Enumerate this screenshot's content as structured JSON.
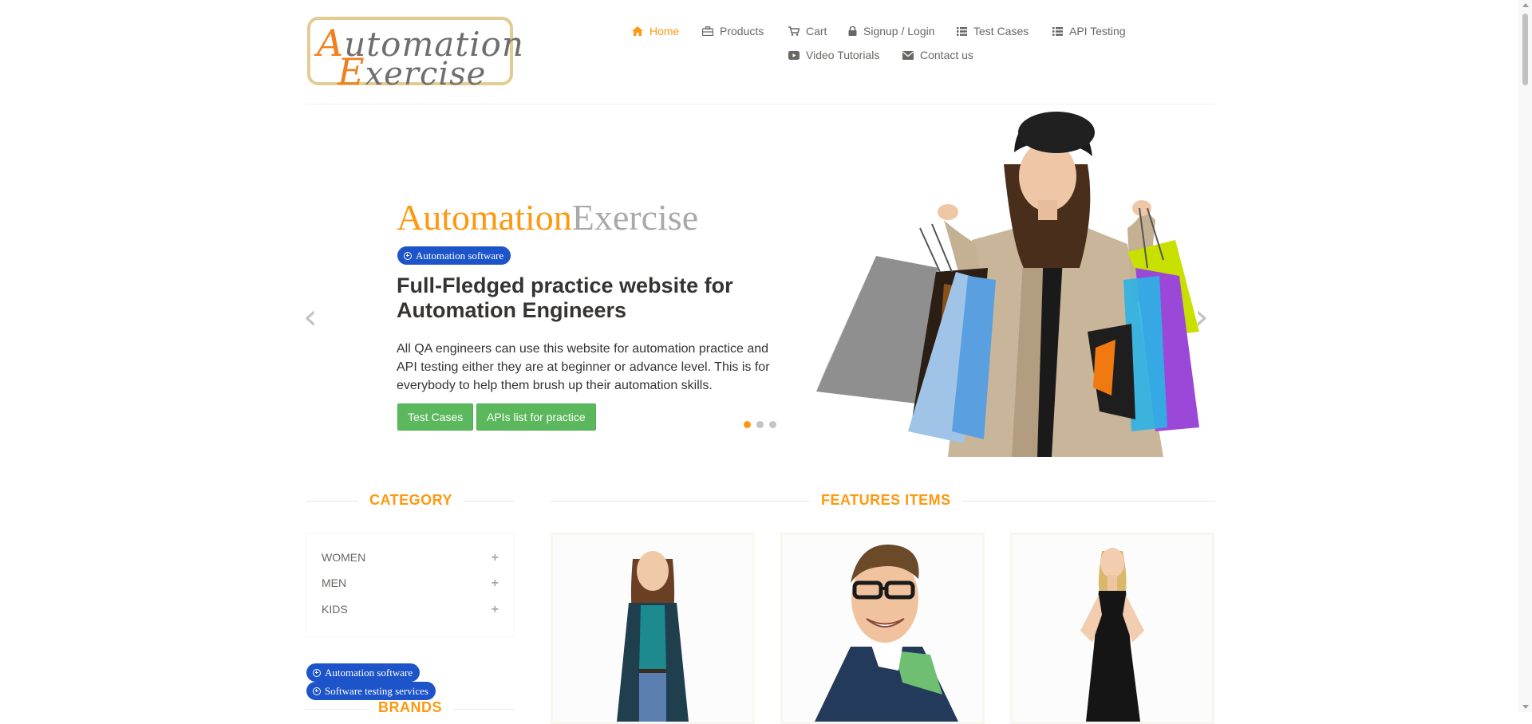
{
  "logo": {
    "line1": "Automation",
    "line2": "Exercise"
  },
  "nav": {
    "items": [
      {
        "label": "Home",
        "icon": "home-icon",
        "active": true
      },
      {
        "label": "Products",
        "icon": "briefcase-icon"
      },
      {
        "label": "Cart",
        "icon": "cart-icon"
      },
      {
        "label": "Signup / Login",
        "icon": "lock-icon"
      },
      {
        "label": "Test Cases",
        "icon": "list-icon"
      },
      {
        "label": "API Testing",
        "icon": "list-icon"
      },
      {
        "label": "Video Tutorials",
        "icon": "youtube-icon"
      },
      {
        "label": "Contact us",
        "icon": "envelope-icon"
      }
    ]
  },
  "slider": {
    "brand_first": "Automation",
    "brand_second": "Exercise",
    "pill": "Automation software",
    "headline": "Full-Fledged practice website for Automation Engineers",
    "description": "All QA engineers can use this website for automation practice and API testing either they are at beginner or advance level. This is for everybody to help them brush up their automation skills.",
    "buttons": {
      "test_cases": "Test Cases",
      "apis": "APIs list for practice"
    },
    "prev_arrow": "‹",
    "next_arrow": "›",
    "active_slide": 1,
    "slide_count": 3
  },
  "sidebar": {
    "category_title": "CATEGORY",
    "categories": [
      {
        "label": "WOMEN",
        "expand": "+"
      },
      {
        "label": "MEN",
        "expand": "+"
      },
      {
        "label": "KIDS",
        "expand": "+"
      }
    ],
    "ad_pills": [
      "Automation software",
      "Software testing services"
    ],
    "brands_title": "BRANDS"
  },
  "features": {
    "title": "FEATURES ITEMS"
  },
  "colors": {
    "accent": "#FE980F",
    "pill": "#1D54C9",
    "button": "#5CB85C",
    "text": "#696763"
  }
}
